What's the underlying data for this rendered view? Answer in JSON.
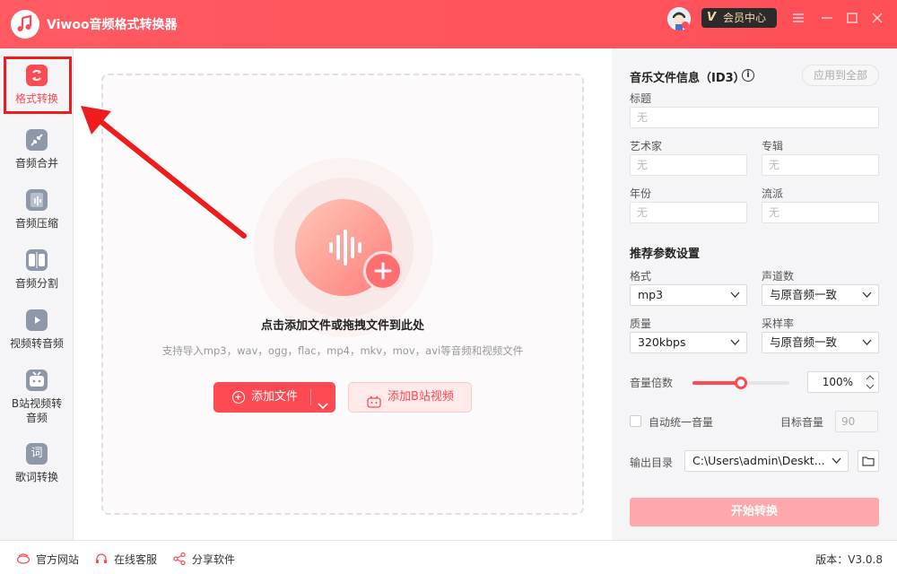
{
  "app": {
    "title": "Viwoo音频格式转换器"
  },
  "header": {
    "vip_label": "会员中心",
    "vip_mark": "V"
  },
  "sidebar": {
    "items": [
      {
        "label": "格式转换",
        "icon": "format-convert-icon"
      },
      {
        "label": "音频合并",
        "icon": "merge-icon"
      },
      {
        "label": "音频压缩",
        "icon": "compress-icon"
      },
      {
        "label": "音频分割",
        "icon": "split-icon"
      },
      {
        "label": "视频转音频",
        "icon": "video-to-audio-icon"
      },
      {
        "label": "B站视频转音频",
        "line1": "B站视频转",
        "line2": "音频",
        "icon": "bilibili-icon"
      },
      {
        "label": "歌词转换",
        "icon": "lyrics-icon",
        "glyph": "词"
      }
    ],
    "active_index": 0
  },
  "main": {
    "drop_title": "点击添加文件或拖拽文件到此处",
    "drop_hint": "支持导入mp3，wav，ogg，flac，mp4，mkv，mov，avi等音频和视频文件",
    "add_file_label": "添加文件",
    "add_bilibili_label": "添加B站视频"
  },
  "panel": {
    "id3_title": "音乐文件信息（ID3）",
    "apply_all": "应用到全部",
    "fields": {
      "title": {
        "label": "标题",
        "placeholder": "无"
      },
      "artist": {
        "label": "艺术家",
        "placeholder": "无"
      },
      "album": {
        "label": "专辑",
        "placeholder": "无"
      },
      "year": {
        "label": "年份",
        "placeholder": "无"
      },
      "genre": {
        "label": "流派",
        "placeholder": "无"
      }
    },
    "params_title": "推荐参数设置",
    "format": {
      "label": "格式",
      "value": "mp3"
    },
    "channels": {
      "label": "声道数",
      "value": "与原音频一致"
    },
    "quality": {
      "label": "质量",
      "value": "320kbps"
    },
    "sample_rate": {
      "label": "采样率",
      "value": "与原音频一致"
    },
    "volume": {
      "label": "音量倍数",
      "value": "100%",
      "slider_fraction": 0.5
    },
    "auto_volume": {
      "label": "自动统一音量",
      "checked": false
    },
    "target_volume": {
      "label": "目标音量",
      "value": "90"
    },
    "output": {
      "label": "输出目录",
      "value": "C:\\Users\\admin\\Deskt..."
    },
    "start_label": "开始转换"
  },
  "footer": {
    "website": "官方网站",
    "support": "在线客服",
    "share": "分享软件",
    "version": "版本：V3.0.8"
  },
  "colors": {
    "brand": "#ff4a53",
    "annotation": "#ee1c1c"
  }
}
